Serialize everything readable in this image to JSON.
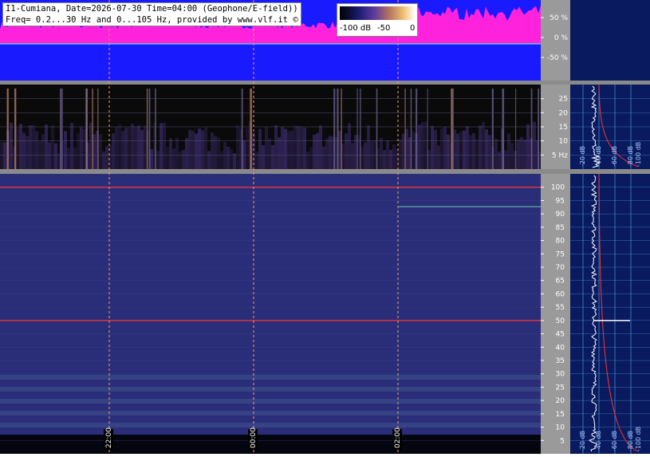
{
  "header": {
    "line1": "I1-Cumiana, Date=2026-07-30 Time=04:00 (Geophone/E-field))",
    "line2": "Freq= 0.2...30 Hz and 0...105 Hz, provided by www.vlf.it ©"
  },
  "colorbar": {
    "labels": [
      "-100 dB",
      "-50",
      "0"
    ]
  },
  "colors": {
    "amplitude_bg": "#1a1aff",
    "amplitude_fill": "#ff22dd",
    "amplitude_trace": "#55ddcc",
    "spectrogram_bg": "#0a0a0a",
    "spectrogram_hf_bg": "#2a2e78",
    "axis_panel": "#9a9a9a",
    "side_panel": "#0a1a5e",
    "side_grid": "#4a9adf",
    "marker_line": "#ff9966",
    "power_line": "#ff3333"
  },
  "chart_data": [
    {
      "type": "area",
      "name_hint": "amplitude",
      "yticks": [
        "50 %",
        "0 %",
        "-50 %"
      ],
      "y": [
        50,
        0,
        -50
      ],
      "ylim": [
        -100,
        100
      ]
    },
    {
      "type": "heatmap",
      "name_hint": "lf-spectrogram",
      "ylim": [
        0,
        30
      ],
      "yticks": [
        "25",
        "20",
        "15",
        "10",
        "5 Hz"
      ],
      "y": [
        25,
        20,
        15,
        10,
        5
      ],
      "side_xticks": [
        "-20 dB",
        "-40 dB",
        "-60 dB",
        "-80 dB",
        "-100 dB"
      ]
    },
    {
      "type": "heatmap",
      "name_hint": "hf-spectrogram",
      "ylim": [
        0,
        105
      ],
      "yticks": [
        "100",
        "95",
        "90",
        "85",
        "80",
        "75",
        "70",
        "65",
        "60",
        "55",
        "50",
        "45",
        "40",
        "35",
        "30",
        "25",
        "20",
        "15",
        "10",
        "5"
      ],
      "y": [
        100,
        95,
        90,
        85,
        80,
        75,
        70,
        65,
        60,
        55,
        50,
        45,
        40,
        35,
        30,
        25,
        20,
        15,
        10,
        5
      ],
      "side_xticks": [
        "-20 dB",
        "-40 dB",
        "-60 dB",
        "-80 dB",
        "-100 dB"
      ],
      "time_markers": [
        "22:00",
        "00:00",
        "02:00"
      ],
      "lines_hz": [
        100,
        50
      ]
    }
  ]
}
